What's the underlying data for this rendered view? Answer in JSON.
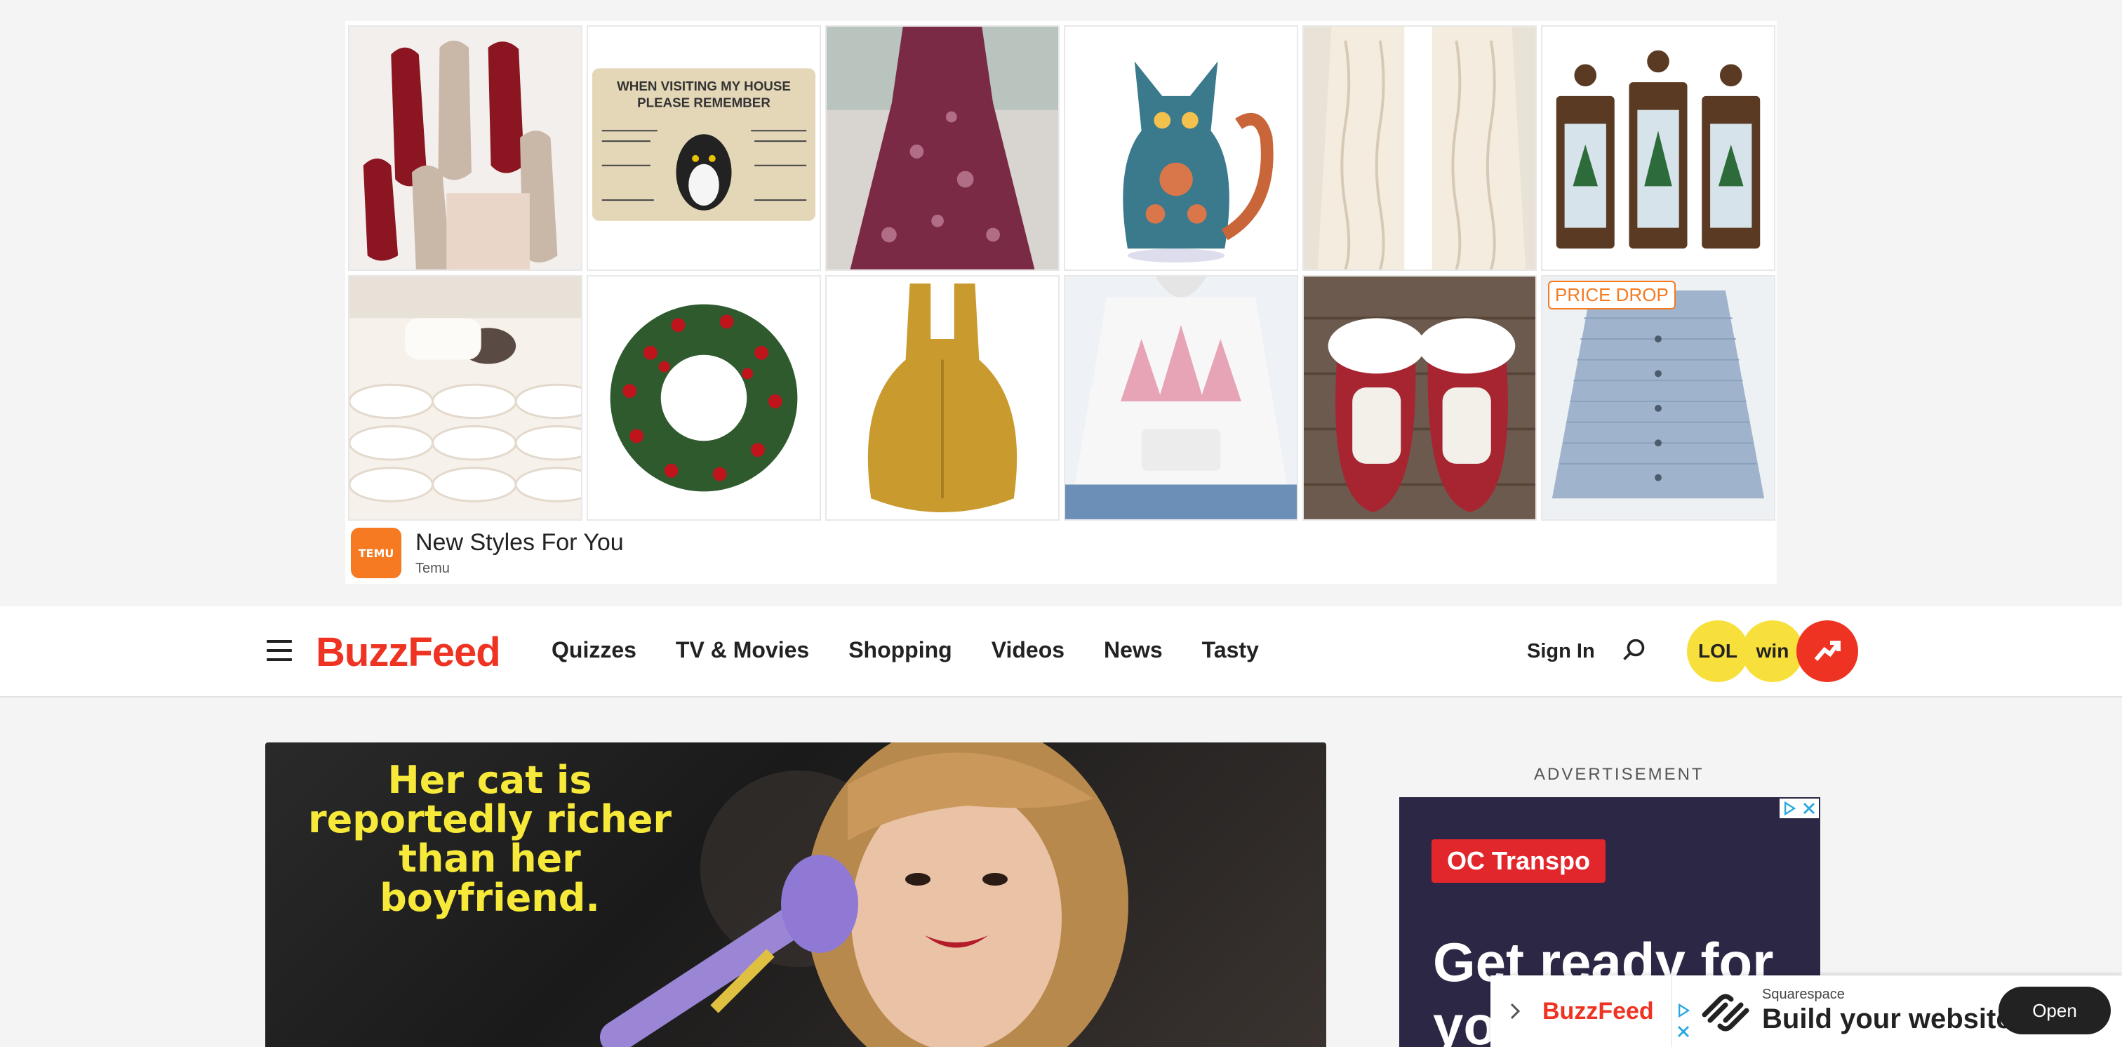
{
  "top_ad": {
    "tiles": [
      {
        "name": "nails"
      },
      {
        "name": "cat-doormat",
        "text_line1": "WHEN VISITING MY HOUSE",
        "text_line2": "PLEASE REMEMBER"
      },
      {
        "name": "paisley-dress"
      },
      {
        "name": "paisley-cat-figure"
      },
      {
        "name": "cable-knit-cardigan"
      },
      {
        "name": "christmas-lanterns"
      },
      {
        "name": "faux-fur-blanket"
      },
      {
        "name": "christmas-wreath"
      },
      {
        "name": "mustard-backpack"
      },
      {
        "name": "christmas-tree-hoodie"
      },
      {
        "name": "gnome-slippers"
      },
      {
        "name": "blue-sweater",
        "badge": "PRICE DROP"
      }
    ],
    "sponsor_logo_text": "TEMU",
    "title": "New Styles For You",
    "sponsor": "Temu"
  },
  "nav": {
    "logo": "BuzzFeed",
    "links": [
      "Quizzes",
      "TV & Movies",
      "Shopping",
      "Videos",
      "News",
      "Tasty"
    ],
    "sign_in": "Sign In",
    "badges": [
      "LOL",
      "win"
    ]
  },
  "hero": {
    "caption": "Her cat is reportedly richer than her boyfriend."
  },
  "side_ad": {
    "label": "ADVERTISEMENT",
    "brand": "OC Transpo",
    "headline_line1": "Get ready for",
    "headline_line2": "yo"
  },
  "sticky": {
    "logo": "BuzzFeed",
    "sponsor": "Squarespace",
    "title": "Build your website",
    "cta": "Open"
  },
  "colors": {
    "brand_red": "#ee3322",
    "temu_orange": "#f57a21",
    "hero_caption_yellow": "#f6e93a",
    "side_ad_bg": "#2b2745"
  }
}
